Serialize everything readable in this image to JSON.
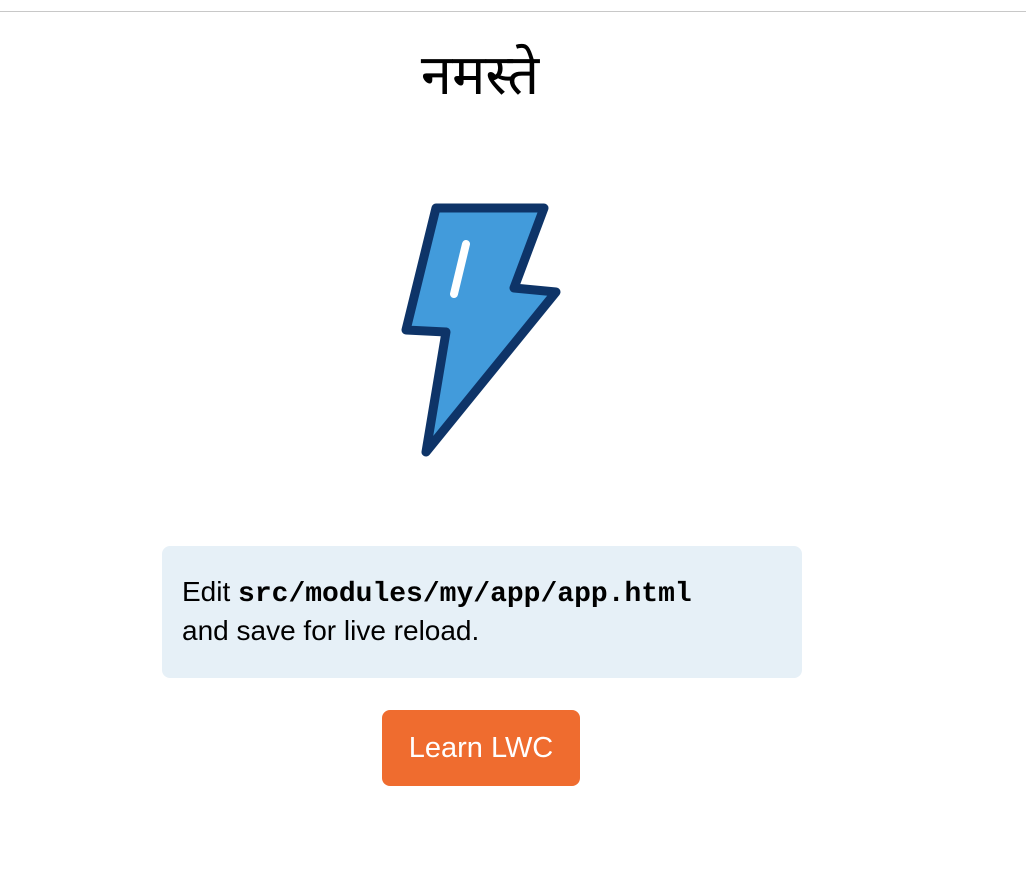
{
  "page": {
    "title": "नमस्ते"
  },
  "logo": {
    "icon": "lightning-bolt-icon",
    "fill_color": "#429bdb",
    "stroke_color": "#0e3468"
  },
  "info": {
    "prefix": "Edit ",
    "path": "src/modules/my/app/app.html",
    "suffix": "and save for live reload."
  },
  "button": {
    "label": "Learn LWC",
    "color": "#ef6c2f"
  }
}
